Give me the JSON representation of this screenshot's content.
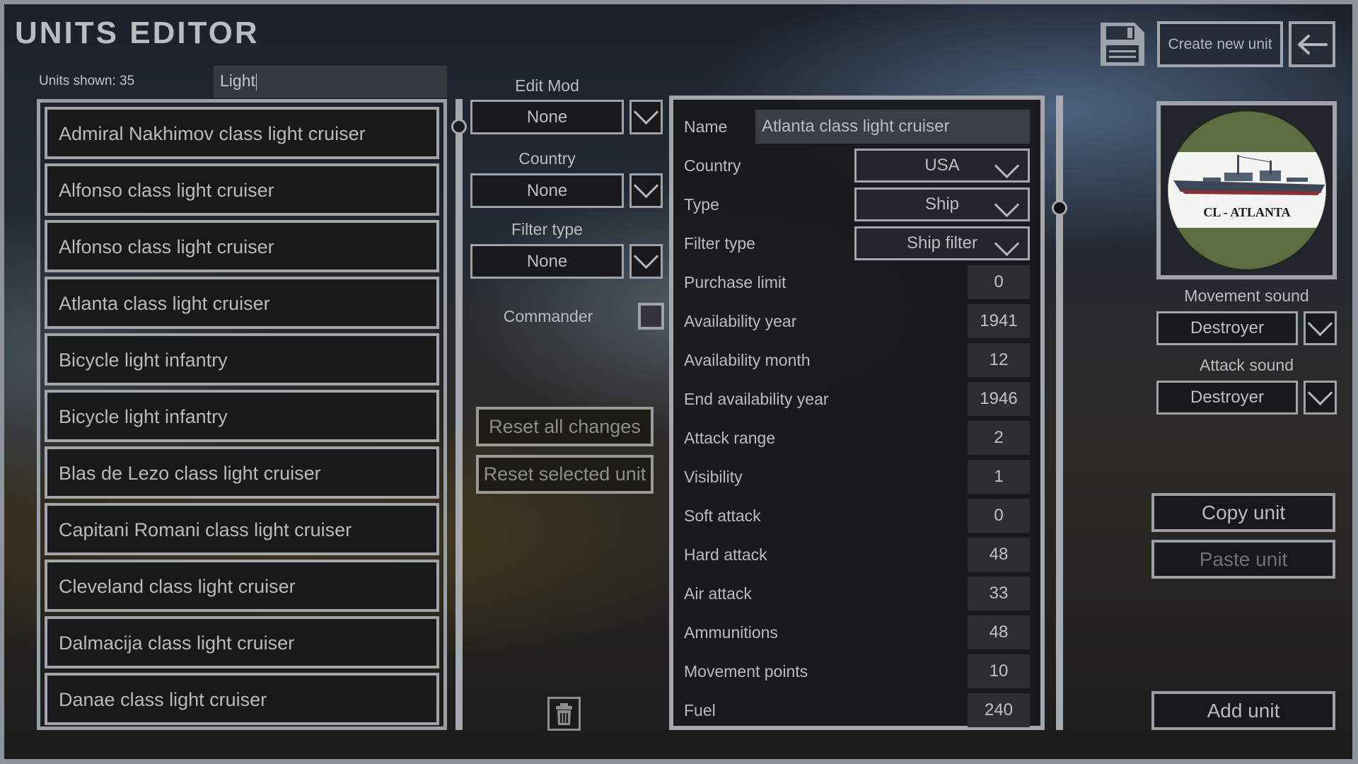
{
  "header": {
    "title": "UNITS EDITOR",
    "units_shown": "Units shown: 35",
    "search_value": "Light",
    "create_new_unit_label": "Create new unit",
    "save_icon": "floppy-disk-icon",
    "back_icon": "arrow-left-icon"
  },
  "unit_list": {
    "items": [
      "Admiral Nakhimov class light cruiser",
      "Alfonso class light cruiser",
      "Alfonso class light cruiser",
      "Atlanta class light cruiser",
      "Bicycle light infantry",
      "Bicycle light infantry",
      "Blas de Lezo class light cruiser",
      "Capitani Romani class light cruiser",
      "Cleveland class light cruiser",
      "Dalmacija class light cruiser",
      "Danae class light cruiser"
    ]
  },
  "filters": {
    "edit_mod_label": "Edit Mod",
    "edit_mod_value": "None",
    "country_label": "Country",
    "country_value": "None",
    "filter_type_label": "Filter type",
    "filter_type_value": "None",
    "commander_label": "Commander",
    "commander_checked": false,
    "reset_all_label": "Reset all changes",
    "reset_selected_label": "Reset selected unit",
    "delete_icon": "trash-icon"
  },
  "details": {
    "name_label": "Name",
    "name_value": "Atlanta class light cruiser",
    "country_label": "Country",
    "country_value": "USA",
    "type_label": "Type",
    "type_value": "Ship",
    "filter_type_label": "Filter type",
    "filter_type_value": "Ship filter",
    "stats": [
      {
        "label": "Purchase limit",
        "value": "0"
      },
      {
        "label": "Availability year",
        "value": "1941"
      },
      {
        "label": "Availability month",
        "value": "12"
      },
      {
        "label": "End availability year",
        "value": "1946"
      },
      {
        "label": "Attack range",
        "value": "2"
      },
      {
        "label": "Visibility",
        "value": "1"
      },
      {
        "label": "Soft attack",
        "value": "0"
      },
      {
        "label": "Hard attack",
        "value": "48"
      },
      {
        "label": "Air attack",
        "value": "33"
      },
      {
        "label": "Ammunitions",
        "value": "48"
      },
      {
        "label": "Movement points",
        "value": "10"
      },
      {
        "label": "Fuel",
        "value": "240"
      }
    ]
  },
  "side": {
    "unit_image_caption": "CL - ATLANTA",
    "movement_sound_label": "Movement sound",
    "movement_sound_value": "Destroyer",
    "attack_sound_label": "Attack sound",
    "attack_sound_value": "Destroyer",
    "copy_unit_label": "Copy unit",
    "paste_unit_label": "Paste unit",
    "add_unit_label": "Add unit"
  },
  "colors": {
    "badge_green": "#5c6e40",
    "badge_white": "#f4f4f2"
  }
}
